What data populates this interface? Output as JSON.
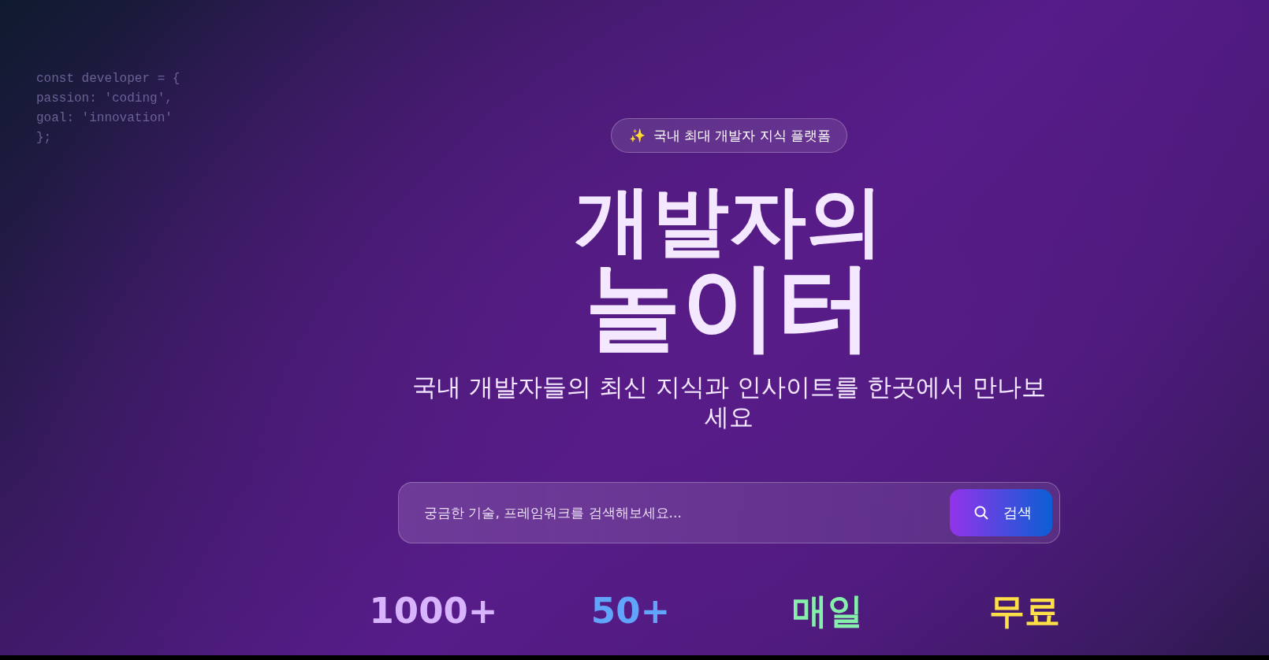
{
  "code_snippet": [
    "const developer = {",
    "passion: 'coding',",
    "goal: 'innovation'",
    "};"
  ],
  "badge": {
    "icon": "✨",
    "label": "국내 최대 개발자 지식 플랫폼"
  },
  "title": {
    "line_1": "개발자의",
    "line_2": "놀이터"
  },
  "subtitle": "국내 개발자들의 최신 지식과 인사이트를 한곳에서 만나보세요",
  "search": {
    "placeholder": "궁금한 기술, 프레임워크를 검색해보세요...",
    "button": "검색"
  },
  "stats": [
    {
      "value": "1000+",
      "color": "#d8b4fe"
    },
    {
      "value": "50+",
      "color": "#60a5fa"
    },
    {
      "value": "매일",
      "color": "#86efac"
    },
    {
      "value": "무료",
      "color": "#fde047"
    }
  ]
}
